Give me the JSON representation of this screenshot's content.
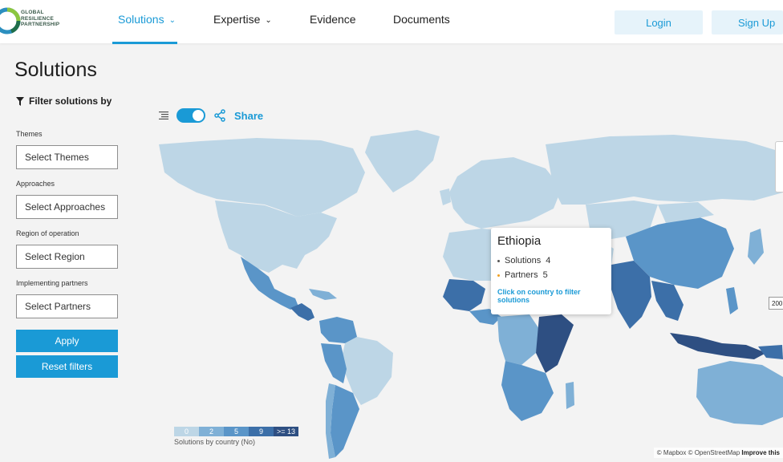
{
  "nav": {
    "logo_lines": [
      "GLOBAL",
      "RESILIENCE",
      "PARTNERSHIP"
    ],
    "items": [
      {
        "label": "Solutions",
        "has_chevron": true,
        "active": true
      },
      {
        "label": "Expertise",
        "has_chevron": true,
        "active": false
      },
      {
        "label": "Evidence",
        "has_chevron": false,
        "active": false
      },
      {
        "label": "Documents",
        "has_chevron": false,
        "active": false
      }
    ],
    "login_label": "Login",
    "signup_label": "Sign Up"
  },
  "page": {
    "title": "Solutions"
  },
  "filters": {
    "heading": "Filter solutions by",
    "fields": [
      {
        "label": "Themes",
        "value": "Select Themes"
      },
      {
        "label": "Approaches",
        "value": "Select Approaches"
      },
      {
        "label": "Region of operation",
        "value": "Select Region"
      },
      {
        "label": "Implementing partners",
        "value": "Select Partners"
      }
    ],
    "apply_label": "Apply",
    "reset_label": "Reset filters"
  },
  "map": {
    "share_label": "Share",
    "toggle_on": true,
    "legend": {
      "bins": [
        "0",
        "2",
        "5",
        "9",
        ">= 13"
      ],
      "colors": [
        "#bdd6e6",
        "#7fb0d6",
        "#5a95c8",
        "#3c6fa8",
        "#2e4f82"
      ],
      "caption": "Solutions by country (No)"
    },
    "tooltip": {
      "country": "Ethiopia",
      "solutions_label": "Solutions",
      "solutions_value": "4",
      "partners_label": "Partners",
      "partners_value": "5",
      "link": "Click on country to filter solutions",
      "solutions_dot_color": "#555555",
      "partners_dot_color": "#f0a020"
    },
    "attribution_text": "© Mapbox © OpenStreetMap",
    "attribution_link": "Improve this",
    "scale_text": "200",
    "colors": {
      "ocean": "#f3f3f3",
      "land_default": "#bdd6e6",
      "level_1": "#7fb0d6",
      "level_2": "#5a95c8",
      "level_3": "#3c6fa8",
      "level_4": "#2e4f82"
    }
  },
  "theme": {
    "accent": "#1a9ad6",
    "accent_light": "#e6f3fa"
  }
}
